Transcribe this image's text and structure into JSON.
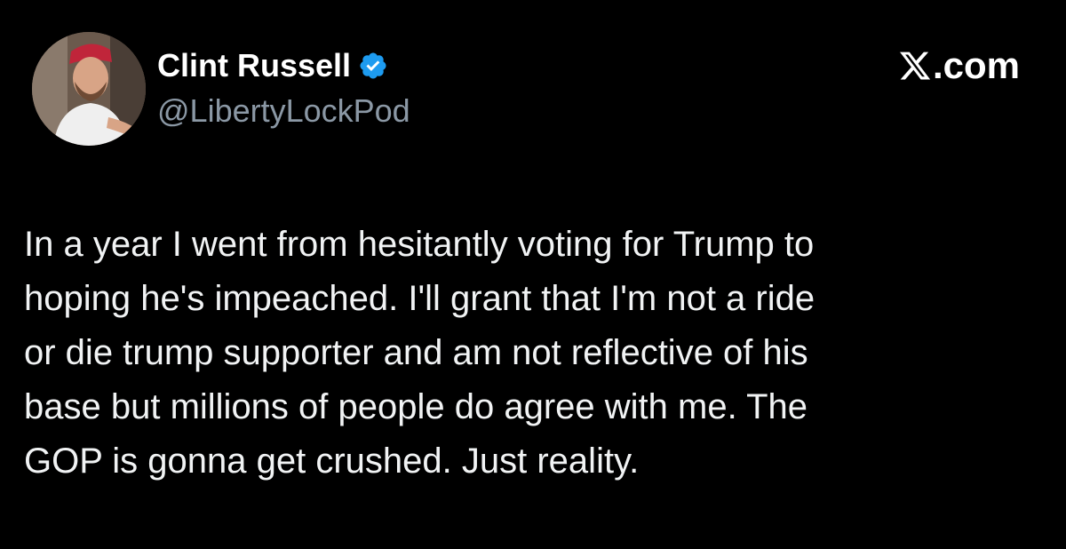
{
  "author": {
    "display_name": "Clint Russell",
    "handle": "@LibertyLockPod",
    "verified": true,
    "avatar_icon": "profile-photo"
  },
  "brand": {
    "label": ".com",
    "icon": "x-logo-icon"
  },
  "tweet": {
    "text": "In a year I went from hesitantly voting for Trump to\nhoping he's impeached. I'll grant that I'm not a ride\nor die trump supporter and am not reflective of his\nbase but millions of people do agree with me. The\nGOP is gonna get crushed. Just reality."
  },
  "colors": {
    "background": "#000000",
    "text": "#e7e9ea",
    "secondary_text": "#8b98a5",
    "verified_badge": "#1d9bf0"
  }
}
